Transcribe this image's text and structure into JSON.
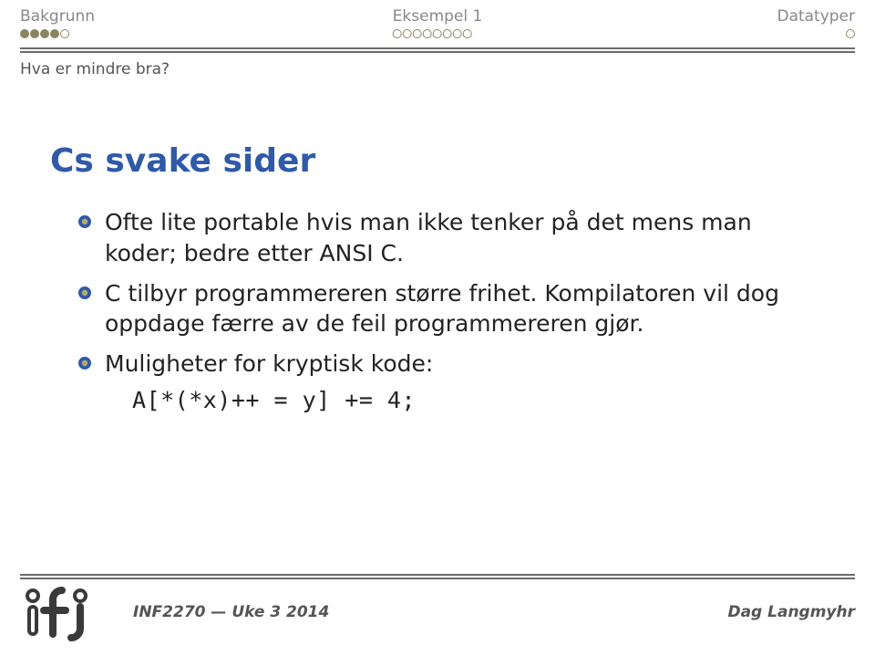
{
  "nav": {
    "left": {
      "label": "Bakgrunn",
      "dots": 5,
      "filled": [
        0,
        1,
        2,
        3
      ]
    },
    "mid": {
      "label": "Eksempel 1",
      "dots": 8,
      "filled": []
    },
    "right": {
      "label": "Datatyper",
      "dots": 1,
      "filled": []
    }
  },
  "subtitle": "Hva er mindre bra?",
  "heading": "Cs svake sider",
  "bullets": [
    "Ofte lite portable hvis man ikke tenker på det mens man koder; bedre etter ANSI C.",
    "C tilbyr programmereren større frihet. Kompilatoren vil dog oppdage færre av de feil programmereren gjør.",
    "Muligheter for kryptisk kode:"
  ],
  "code": "A[*(*x)++ = y] += 4;",
  "footer": {
    "course": "INF2270 — Uke 3 2014",
    "author": "Dag Langmyhr"
  }
}
